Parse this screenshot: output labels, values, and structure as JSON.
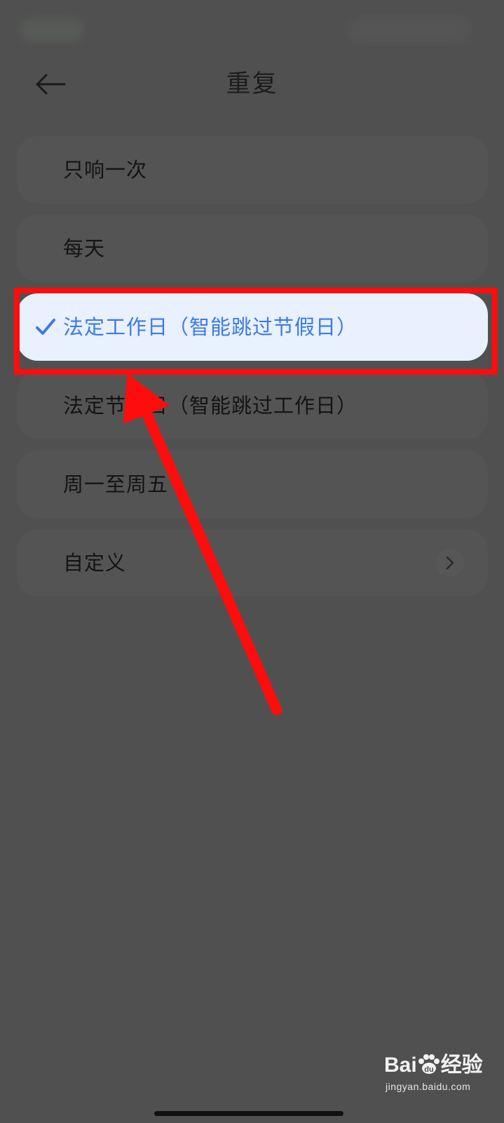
{
  "header": {
    "title": "重复",
    "back_icon": "arrow-left-icon"
  },
  "options": [
    {
      "label": "只响一次",
      "selected": false
    },
    {
      "label": "每天",
      "selected": false
    },
    {
      "label": "法定工作日（智能跳过节假日）",
      "selected": true
    },
    {
      "label": "法定节假日（智能跳过工作日）",
      "selected": false
    },
    {
      "label": "周一至周五",
      "selected": false
    },
    {
      "label": "自定义",
      "selected": false,
      "has_chevron": true
    }
  ],
  "watermark": {
    "logo_left": "Bai",
    "logo_right": "经验",
    "url": "jingyan.baidu.com"
  },
  "colors": {
    "accent": "#3b7be6",
    "selected_bg": "#e9f0fe",
    "highlight": "#ff0d0d",
    "overlay_bg": "#505050"
  }
}
